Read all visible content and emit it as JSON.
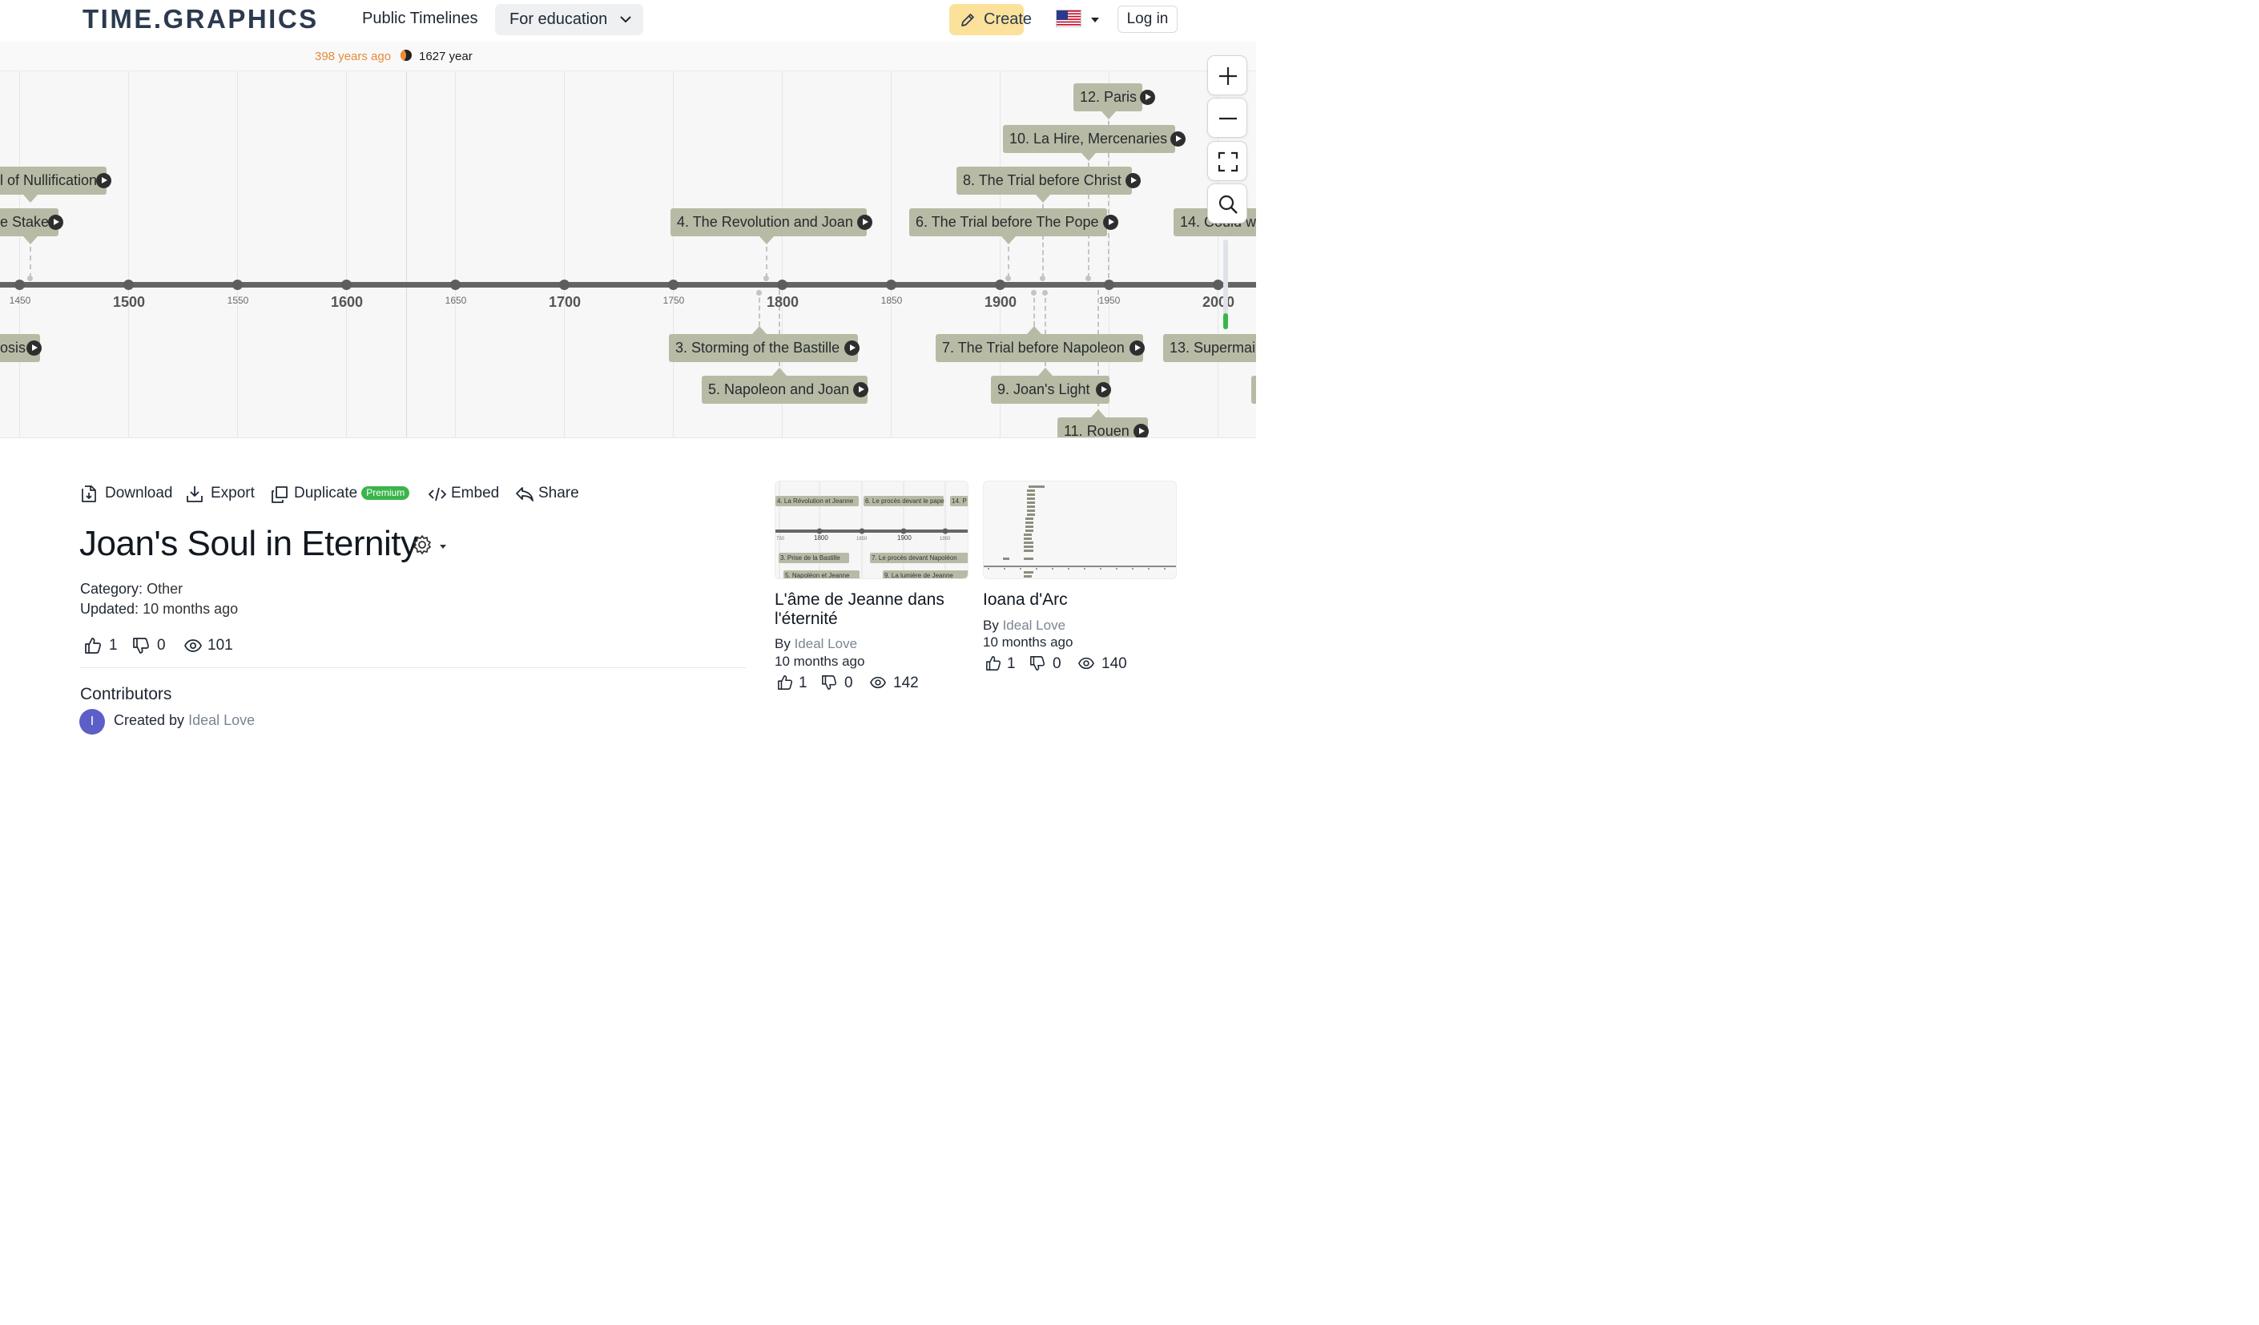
{
  "header": {
    "logo": "TIME.GRAPHICS",
    "nav_public": "Public Timelines",
    "nav_education": "For education",
    "create_label": "Create",
    "login_label": "Log in"
  },
  "ruler": {
    "ago": "398 years ago",
    "year": "1627 year"
  },
  "axis_ticks": [
    "1450",
    "1500",
    "1550",
    "1600",
    "1650",
    "1700",
    "1750",
    "1800",
    "1850",
    "1900",
    "1950",
    "2000"
  ],
  "events": {
    "e_nullification": "l of Nullification",
    "e_stake": "e Stake",
    "e_osis": "osis",
    "e4": "4. The Revolution and Joan",
    "e3": "3. Storming of the Bastille",
    "e5": "5. Napoleon and Joan",
    "e12": "12. Paris",
    "e10": "10. La Hire, Mercenaries",
    "e8": "8. The Trial before Christ",
    "e6": "6. The Trial before The Pope",
    "e7": "7. The Trial before Napoleon",
    "e9": "9. Joan's Light",
    "e11": "11. Rouen",
    "e14": "14. Could w",
    "e13": "13. Supermai"
  },
  "actions": {
    "download": "Download",
    "export": "Export",
    "duplicate": "Duplicate",
    "premium": "Premium",
    "embed": "Embed",
    "share": "Share"
  },
  "timeline": {
    "title": "Joan's Soul in Eternity",
    "category_label": "Category:",
    "category_value": "Other",
    "updated_label": "Updated:",
    "updated_value": "10 months ago",
    "likes": "1",
    "dislikes": "0",
    "views": "101"
  },
  "contributors": {
    "heading": "Contributors",
    "avatar_letter": "I",
    "created_by": "Created by",
    "author": "Ideal Love"
  },
  "related": [
    {
      "title": "L'âme de Jeanne dans l'éternité",
      "by": "By",
      "author": "Ideal Love",
      "date": "10 months ago",
      "likes": "1",
      "dislikes": "0",
      "views": "142"
    },
    {
      "title": "Ioana d'Arc",
      "by": "By",
      "author": "Ideal Love",
      "date": "10 months ago",
      "likes": "1",
      "dislikes": "0",
      "views": "140"
    }
  ],
  "thumb_labels": {
    "t1": "4. La Révolution et Jeanne",
    "t2": "6. Le procès devant le pape",
    "t3": "14. P",
    "t4": "3. Prise de la Bastille",
    "t5": "7. Le procès devant Napoléon",
    "t6": "5. Napoléon et Jeanne",
    "t7": "9. La lumière de Jeanne",
    "t_axis_1800": "1800",
    "t_axis_1900": "1900",
    "t_axis_750": "750",
    "t_axis_1850": "1850",
    "t_axis_1950": "1950"
  },
  "colors": {
    "accent_create": "#fbe19a",
    "event_bg": "#b7bba5",
    "premium": "#3bb54a",
    "ago_text": "#e68a3c",
    "avatar": "#5b5fc7"
  }
}
